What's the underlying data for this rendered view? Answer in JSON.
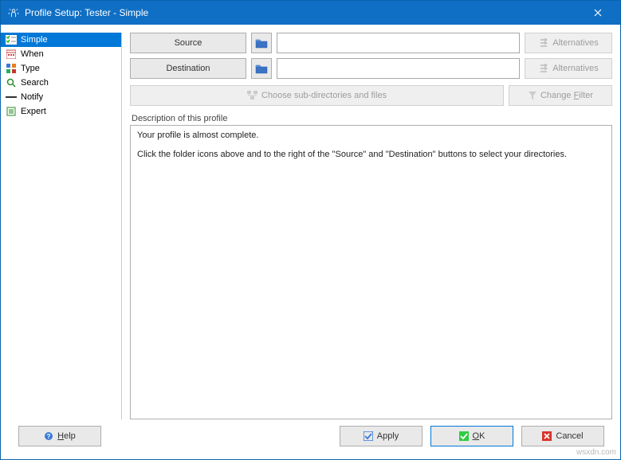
{
  "title": "Profile Setup: Tester - Simple",
  "sidebar": {
    "items": [
      {
        "label": "Simple",
        "selected": true
      },
      {
        "label": "When",
        "selected": false
      },
      {
        "label": "Type",
        "selected": false
      },
      {
        "label": "Search",
        "selected": false
      },
      {
        "label": "Notify",
        "selected": false
      },
      {
        "label": "Expert",
        "selected": false
      }
    ]
  },
  "source": {
    "button_label": "Source",
    "path": "",
    "placeholder": "",
    "alternatives_label": "Alternatives"
  },
  "destination": {
    "button_label": "Destination",
    "path": "",
    "placeholder": "",
    "alternatives_label": "Alternatives"
  },
  "choose_sub_label": "Choose sub-directories and files",
  "change_filter_label": "Change Filter",
  "group_label": "Description of this profile",
  "description": {
    "line1": "Your profile is almost complete.",
    "line2": "Click the folder icons above and to the right of the \"Source\" and \"Destination\" buttons to select your directories."
  },
  "footer": {
    "help": "Help",
    "apply": "Apply",
    "ok": "OK",
    "cancel": "Cancel"
  },
  "watermark": "wsxdn.com"
}
